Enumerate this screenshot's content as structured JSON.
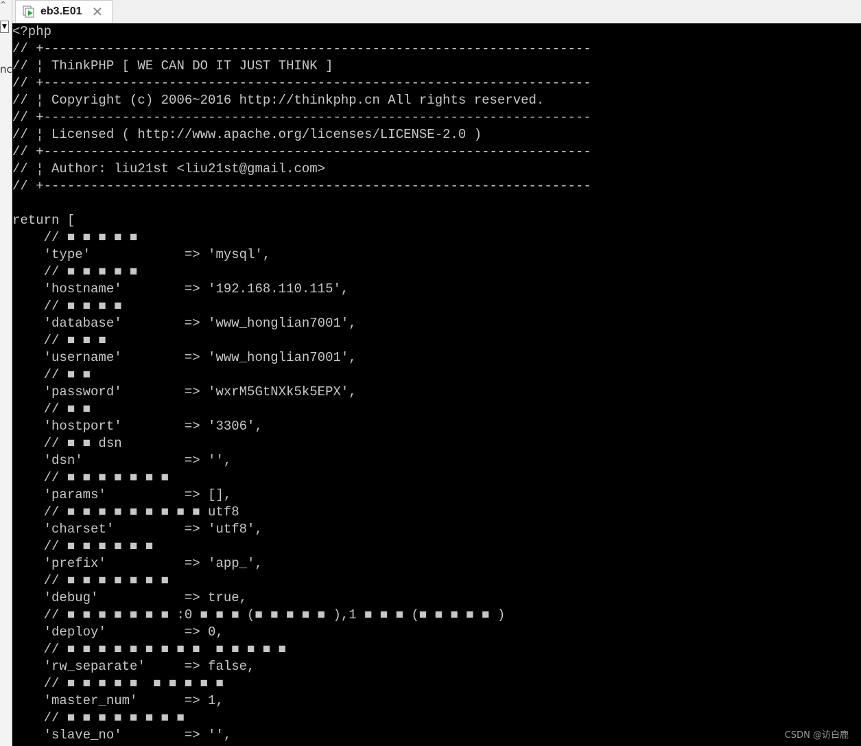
{
  "left_panel": {
    "dropdown_glyph": "▼",
    "text_fragment": "nc",
    "caret": "^"
  },
  "tab": {
    "label": "eb3.E01",
    "close": "✕",
    "icon": "vm-play-icon"
  },
  "console": {
    "lines": [
      "<?php",
      "// +----------------------------------------------------------------------",
      "// ¦ ThinkPHP [ WE CAN DO IT JUST THINK ]",
      "// +----------------------------------------------------------------------",
      "// ¦ Copyright (c) 2006~2016 http://thinkphp.cn All rights reserved.",
      "// +----------------------------------------------------------------------",
      "// ¦ Licensed ( http://www.apache.org/licenses/LICENSE-2.0 )",
      "// +----------------------------------------------------------------------",
      "// ¦ Author: liu21st <liu21st@gmail.com>",
      "// +----------------------------------------------------------------------",
      "",
      "return [",
      "    // ■ ■ ■ ■ ■",
      "    'type'            => 'mysql',",
      "    // ■ ■ ■ ■ ■",
      "    'hostname'        => '192.168.110.115',",
      "    // ■ ■ ■ ■",
      "    'database'        => 'www_honglian7001',",
      "    // ■ ■ ■",
      "    'username'        => 'www_honglian7001',",
      "    // ■ ■",
      "    'password'        => 'wxrM5GtNXk5k5EPX',",
      "    // ■ ■",
      "    'hostport'        => '3306',",
      "    // ■ ■ dsn",
      "    'dsn'             => '',",
      "    // ■ ■ ■ ■ ■ ■ ■",
      "    'params'          => [],",
      "    // ■ ■ ■ ■ ■ ■ ■ ■ ■ utf8",
      "    'charset'         => 'utf8',",
      "    // ■ ■ ■ ■ ■ ■",
      "    'prefix'          => 'app_',",
      "    // ■ ■ ■ ■ ■ ■ ■",
      "    'debug'           => true,",
      "    // ■ ■ ■ ■ ■ ■ ■ :0 ■ ■ ■ (■ ■ ■ ■ ■ ),1 ■ ■ ■ (■ ■ ■ ■ ■ )",
      "    'deploy'          => 0,",
      "    // ■ ■ ■ ■ ■ ■ ■ ■ ■  ■ ■ ■ ■ ■",
      "    'rw_separate'     => false,",
      "    // ■ ■ ■ ■ ■  ■ ■ ■ ■ ■",
      "    'master_num'      => 1,",
      "    // ■ ■ ■ ■ ■ ■ ■ ■",
      "    'slave_no'        => '',"
    ]
  },
  "watermark": "CSDN @访白鹿",
  "colors": {
    "console_bg": "#000000",
    "console_fg": "#c8c8c8",
    "tab_bg": "#ffffff",
    "tabbar_bg": "#f0f0f0"
  }
}
